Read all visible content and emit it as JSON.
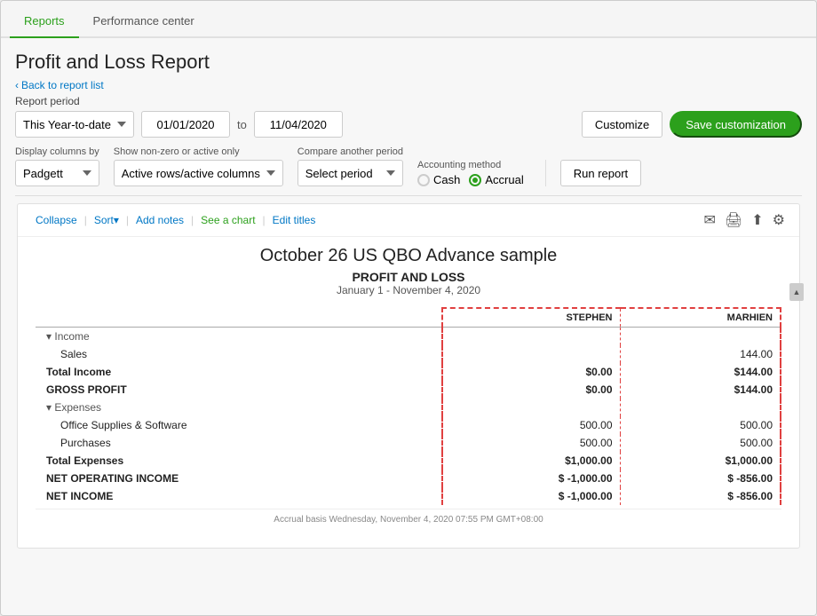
{
  "tabs": [
    {
      "id": "reports",
      "label": "Reports",
      "active": true
    },
    {
      "id": "performance",
      "label": "Performance center",
      "active": false
    }
  ],
  "page": {
    "title": "Profit and Loss Report",
    "back_link": "Back to report list"
  },
  "report_period": {
    "label": "Report period",
    "period_select": "This Year-to-date",
    "from_date": "01/01/2020",
    "to_label": "to",
    "to_date": "11/04/2020"
  },
  "buttons": {
    "customize": "Customize",
    "save_customization": "Save customization",
    "run_report": "Run report"
  },
  "display_columns": {
    "label": "Display columns by",
    "value": "Padgett"
  },
  "show_nonzero": {
    "label": "Show non-zero or active only",
    "value": "Active rows/active columns"
  },
  "compare_period": {
    "label": "Compare another period",
    "value": "Select period"
  },
  "accounting_method": {
    "label": "Accounting method",
    "cash": "Cash",
    "accrual": "Accrual",
    "selected": "accrual"
  },
  "toolbar": {
    "collapse": "Collapse",
    "sort": "Sort▾",
    "add_notes": "Add notes",
    "see_chart": "See a chart",
    "edit_titles": "Edit titles"
  },
  "report": {
    "company": "October 26 US QBO Advance sample",
    "title": "PROFIT AND LOSS",
    "subtitle": "January 1 - November 4, 2020",
    "columns": [
      "",
      "STEPHEN",
      "MARHIEN"
    ],
    "rows": [
      {
        "type": "section",
        "label": "▾ Income",
        "stephen": "",
        "marhien": ""
      },
      {
        "type": "indent",
        "label": "Sales",
        "stephen": "",
        "marhien": "144.00"
      },
      {
        "type": "bold",
        "label": "Total Income",
        "stephen": "$0.00",
        "marhien": "$144.00"
      },
      {
        "type": "bold",
        "label": "GROSS PROFIT",
        "stephen": "$0.00",
        "marhien": "$144.00"
      },
      {
        "type": "section",
        "label": "▾ Expenses",
        "stephen": "",
        "marhien": ""
      },
      {
        "type": "indent",
        "label": "Office Supplies & Software",
        "stephen": "500.00",
        "marhien": "500.00"
      },
      {
        "type": "indent",
        "label": "Purchases",
        "stephen": "500.00",
        "marhien": "500.00"
      },
      {
        "type": "bold",
        "label": "Total Expenses",
        "stephen": "$1,000.00",
        "marhien": "$1,000.00"
      },
      {
        "type": "bold",
        "label": "NET OPERATING INCOME",
        "stephen": "$ -1,000.00",
        "marhien": "$ -856.00"
      },
      {
        "type": "bold-highlight",
        "label": "NET INCOME",
        "stephen": "$ -1,000.00",
        "marhien": "$ -856.00"
      }
    ]
  },
  "footer": "Accrual basis  Wednesday, November 4, 2020  07:55 PM GMT+08:00"
}
